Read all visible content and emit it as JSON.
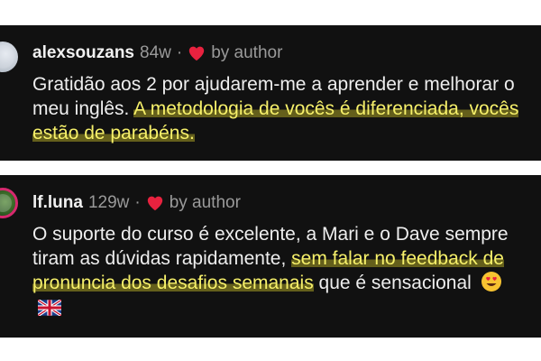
{
  "comments": [
    {
      "username": "alexsouzans",
      "age": "84w",
      "separator": "·",
      "liked_by": "by author",
      "text_plain": "Gratidão aos 2 por ajudarem-me a aprender e melhorar o meu inglês. ",
      "text_highlight": "A metodologia de vocês é diferenciada, vocês estão de parabéns."
    },
    {
      "username": "lf.luna",
      "age": "129w",
      "separator": "·",
      "liked_by": "by author",
      "text_plain": "O suporte do curso é excelente, a Mari e o Dave sempre tiram as dúvidas rapidamente, ",
      "text_highlight": "sem falar no feedback de pronuncia dos desafios semanais",
      "text_tail": " que é sensacional",
      "emoji": "heart-eyes-emoji",
      "flag": "uk-flag-icon"
    }
  ],
  "colors": {
    "card_bg": "#111111",
    "username": "#f1f1f1",
    "meta": "#9a9a9a",
    "heart": "#e8223f",
    "highlight_text": "#f6f06a",
    "story_ring": "#d6296e"
  }
}
